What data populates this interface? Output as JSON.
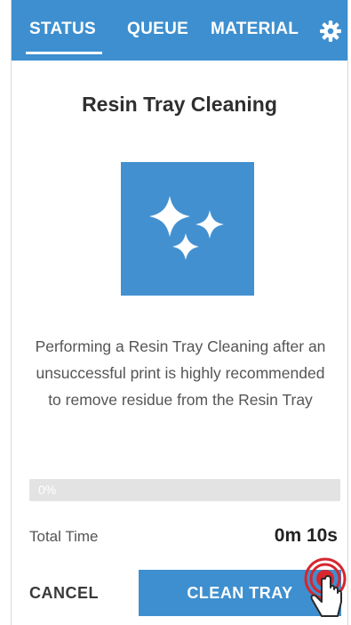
{
  "tabs": [
    {
      "label": "STATUS",
      "active": true
    },
    {
      "label": "QUEUE",
      "active": false
    },
    {
      "label": "MATERIAL",
      "active": false
    }
  ],
  "header": {
    "settings_icon": "gear-icon"
  },
  "page": {
    "title": "Resin Tray Cleaning",
    "hero_icon": "sparkle-icon",
    "description": "Performing a Resin Tray Cleaning after an unsuccessful print is highly recommended to remove residue from the Resin Tray"
  },
  "progress": {
    "label": "0%",
    "value": 0
  },
  "total_time": {
    "label": "Total Time",
    "value": "0m 10s"
  },
  "actions": {
    "cancel": "CANCEL",
    "clean": "CLEAN TRAY"
  },
  "colors": {
    "accent": "#3e8fcf",
    "hero": "#4390d1",
    "progress_track": "#e3e3e3",
    "touch_ring": "#d7262e"
  }
}
